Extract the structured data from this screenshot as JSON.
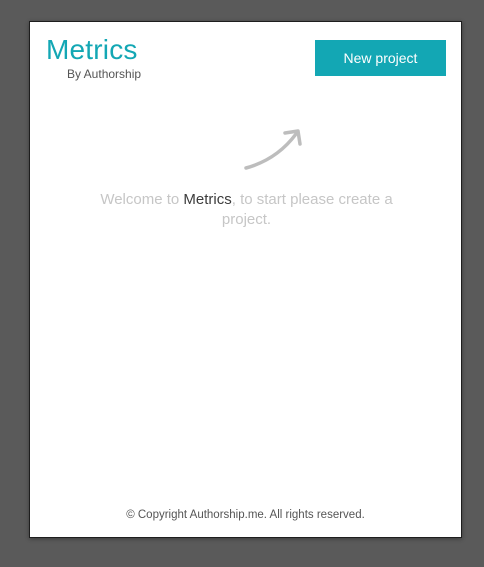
{
  "brand": {
    "title": "Metrics",
    "subtitle": "By Authorship"
  },
  "header": {
    "new_project_label": "New project"
  },
  "welcome": {
    "prefix": "Welcome to ",
    "app_name": "Metrics",
    "suffix": ", to start please create a project.",
    "arrow_icon": "curved-arrow-up-right-icon"
  },
  "footer": {
    "copyright": "© Copyright Authorship.me. All rights reserved."
  },
  "colors": {
    "accent": "#13a7b4",
    "background": "#5a5a5a",
    "panel": "#ffffff",
    "muted_text": "#c6c6c6"
  }
}
